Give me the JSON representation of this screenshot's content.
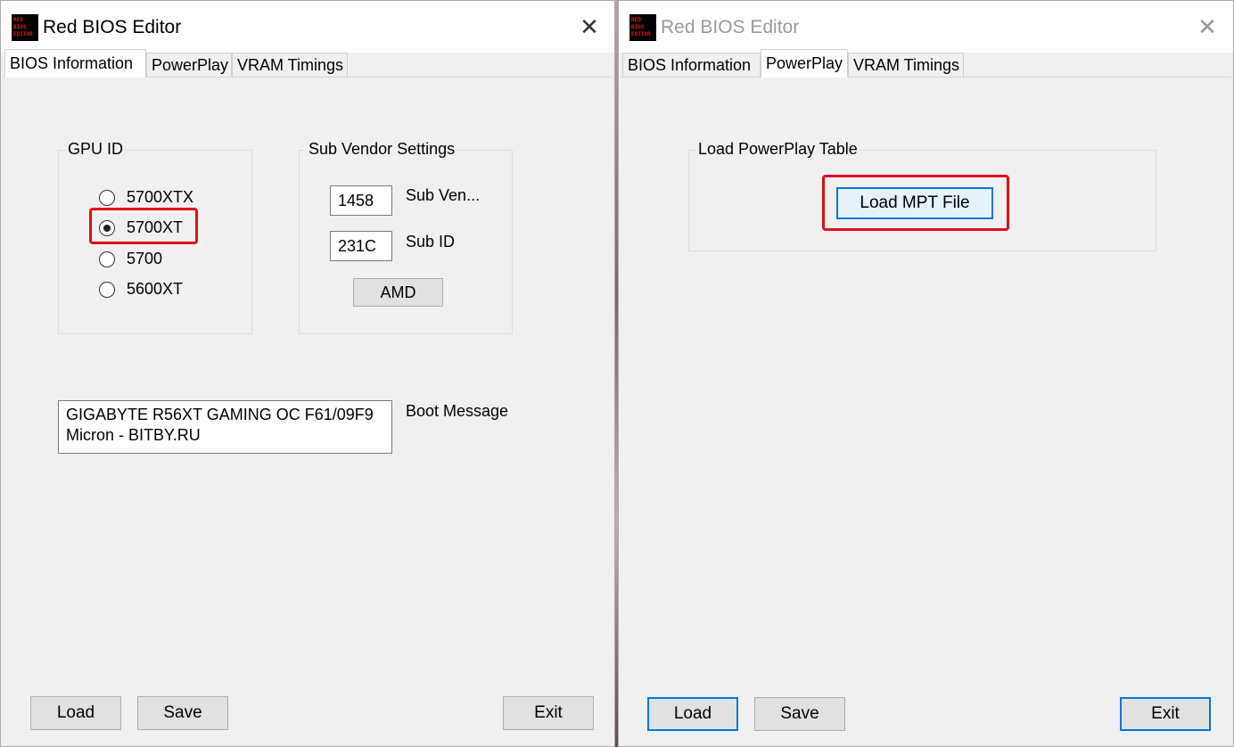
{
  "left_window": {
    "title": "Red BIOS Editor",
    "icon_text": [
      "RED",
      "BIOS",
      "EDITOR"
    ],
    "close_glyph": "✕",
    "tabs": [
      {
        "label": "BIOS Information",
        "active": true
      },
      {
        "label": "PowerPlay",
        "active": false
      },
      {
        "label": "VRAM Timings",
        "active": false
      }
    ],
    "gpu_id": {
      "label": "GPU ID",
      "options": [
        {
          "label": "5700XTX",
          "checked": false
        },
        {
          "label": "5700XT",
          "checked": true
        },
        {
          "label": "5700",
          "checked": false
        },
        {
          "label": "5600XT",
          "checked": false
        }
      ]
    },
    "sub_vendor": {
      "label": "Sub Vendor Settings",
      "sub_vendor_value": "1458",
      "sub_vendor_label": "Sub Ven...",
      "sub_id_value": "231C",
      "sub_id_label": "Sub ID",
      "amd_button": "AMD"
    },
    "boot_message": {
      "line1": "GIGABYTE R56XT GAMING OC F61/09F9",
      "line2": "Micron - BITBY.RU",
      "label": "Boot Message"
    },
    "buttons": {
      "load": "Load",
      "save": "Save",
      "exit": "Exit"
    }
  },
  "right_window": {
    "title": "Red BIOS Editor",
    "icon_text": [
      "RED",
      "BIOS",
      "EDITOR"
    ],
    "close_glyph": "✕",
    "tabs": [
      {
        "label": "BIOS Information",
        "active": false
      },
      {
        "label": "PowerPlay",
        "active": true
      },
      {
        "label": "VRAM Timings",
        "active": false
      }
    ],
    "powerplay": {
      "group_label": "Load PowerPlay Table",
      "load_mpt_button": "Load MPT File"
    },
    "buttons": {
      "load": "Load",
      "save": "Save",
      "exit": "Exit"
    }
  },
  "colors": {
    "highlight": "#e0101a",
    "focus_border": "#0078d7",
    "window_bg": "#f0f0f0"
  }
}
